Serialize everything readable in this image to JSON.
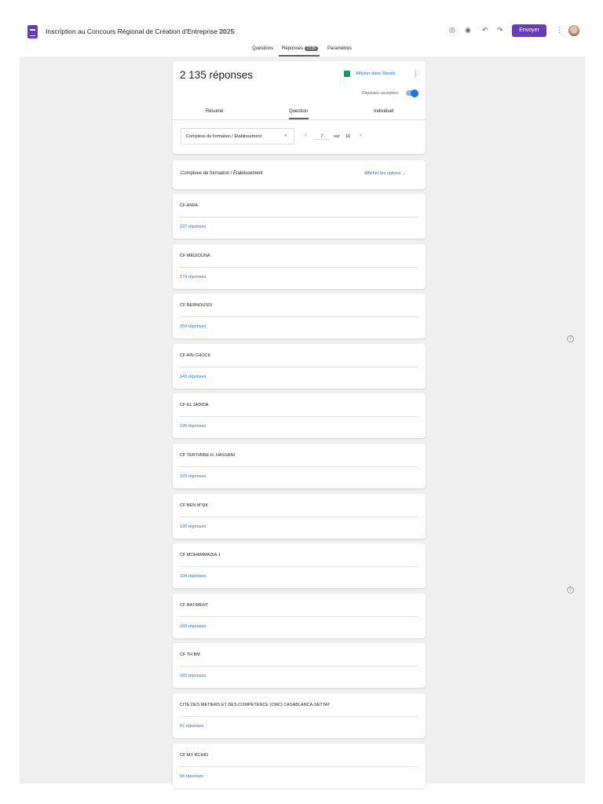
{
  "header": {
    "title": "Inscription au Concours Régional de Création d'Entreprise 2025",
    "send_label": "Envoyer"
  },
  "tabs": {
    "questions": "Questions",
    "responses": "Réponses",
    "responses_count": "2135",
    "settings": "Paramètres"
  },
  "summary": {
    "total": "2 135 réponses",
    "sheets_link": "Afficher dans Sheets",
    "accepting_label": "Réponses acceptées",
    "accepting": true,
    "subtabs": [
      "Résumé",
      "Question",
      "Individuel"
    ],
    "active_subtab": "Question",
    "question_select": "Complexe de formation / Établissement",
    "page": "7",
    "of_label": "sur",
    "total_pages": "16"
  },
  "question": {
    "title": "Complexe de formation / Établissement",
    "options_link": "Afficher les options"
  },
  "answers": [
    {
      "label": "CF ANFA",
      "count": "227 réponses"
    },
    {
      "label": "CF MEDIOUNA",
      "count": "174 réponses"
    },
    {
      "label": "CF BERNOUSSI",
      "count": "154 réponses"
    },
    {
      "label": "CF AIN CHOCK",
      "count": "143 réponses"
    },
    {
      "label": "CF EL JADIDA",
      "count": "135 réponses"
    },
    {
      "label": "CF TERTIAIRE H. HASSANI",
      "count": "123 réponses"
    },
    {
      "label": "CF BEN M'SIK",
      "count": "120 réponses"
    },
    {
      "label": "CF MOHAMMADIA 1",
      "count": "104 réponses"
    },
    {
      "label": "CF BATIMENT",
      "count": "103 réponses"
    },
    {
      "label": "CF TH BM",
      "count": "103 réponses"
    },
    {
      "label": "CITE DES METIERS ET DES COMPETENCE (CMC) CASABLANCA-SETTAT",
      "count": "97 réponses"
    },
    {
      "label": "CF MY RCHID",
      "count": "94 réponses"
    }
  ]
}
